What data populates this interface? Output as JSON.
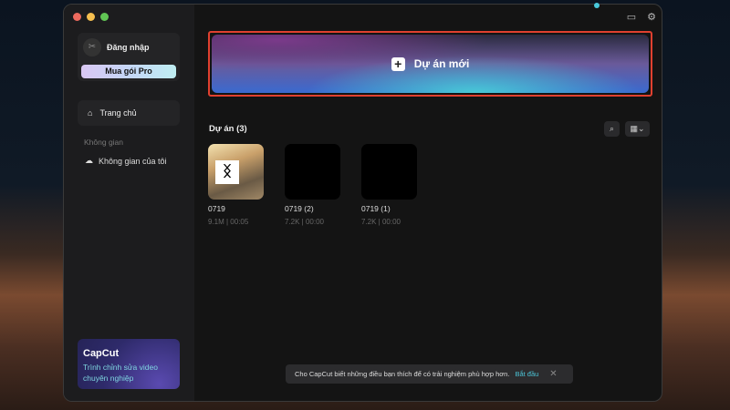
{
  "window": {
    "traffic_lights": [
      "#ed6a5e",
      "#f5bf4f",
      "#61c554"
    ]
  },
  "sidebar": {
    "login": "Đăng nhập",
    "buy_pro": "Mua gói Pro",
    "home": "Trang chủ",
    "section": "Không gian",
    "my_space": "Không gian của tôi",
    "promo": {
      "title": "CapCut",
      "subtitle": "Trình chỉnh sửa video chuyên nghiệp"
    }
  },
  "main": {
    "new_project": "Dự án mới",
    "projects_header": "Dự án  (3)",
    "projects": [
      {
        "name": "0719",
        "meta": "9.1M | 00:05"
      },
      {
        "name": "0719 (2)",
        "meta": "7.2K | 00:00"
      },
      {
        "name": "0719 (1)",
        "meta": "7.2K | 00:00"
      }
    ]
  },
  "toast": {
    "message": "Cho CapCut biết những điều bạn thích để có trải nghiệm phù hợp hơn.",
    "action": "Bắt đầu"
  }
}
